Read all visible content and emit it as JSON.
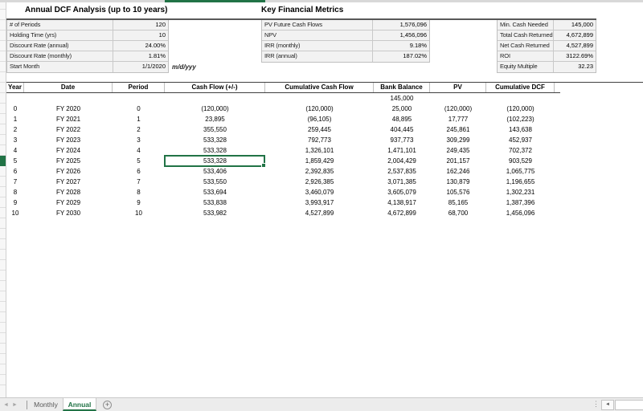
{
  "colors": {
    "accent_green": "#217346",
    "table_fill": "#f2f2f2",
    "table_border": "#bfbfbf",
    "dark_rule": "#595959"
  },
  "left_section": {
    "title": "Annual DCF Analysis (up to 10 years)",
    "rows": [
      {
        "label": "# of Periods",
        "value": "120"
      },
      {
        "label": "Holding Time (yrs)",
        "value": "10"
      },
      {
        "label": "Discount Rate (annual)",
        "value": "24.00%"
      },
      {
        "label": "Discount Rate (monthly)",
        "value": "1.81%"
      },
      {
        "label": "Start Month",
        "value": "1/1/2020"
      }
    ],
    "date_format_note": "m/d/yyy"
  },
  "metrics_section": {
    "title": "Key Financial Metrics",
    "rows": [
      {
        "label": "PV Future Cash Flows",
        "value": "1,576,096"
      },
      {
        "label": "NPV",
        "value": "1,456,096"
      },
      {
        "label": "IRR (monthly)",
        "value": "9.18%"
      },
      {
        "label": "IRR (annual)",
        "value": "187.02%"
      }
    ]
  },
  "returns_section": {
    "rows": [
      {
        "label": "Min. Cash Needed",
        "value": "145,000"
      },
      {
        "label": "Total Cash Returned",
        "value": "4,672,899"
      },
      {
        "label": "Net Cash Returned",
        "value": "4,527,899"
      },
      {
        "label": "ROI",
        "value": "3122.69%"
      },
      {
        "label": "Equity Multiple",
        "value": "32.23"
      }
    ]
  },
  "main_table": {
    "headers": [
      "Year",
      "Date",
      "Period",
      "Cash Flow (+/-)",
      "Cumulative Cash Flow",
      "Bank Balance",
      "PV",
      "Cumulative DCF"
    ],
    "initial_row": [
      "",
      "",
      "",
      "",
      "",
      "145,000",
      "",
      ""
    ],
    "rows": [
      [
        "0",
        "FY 2020",
        "0",
        "(120,000)",
        "(120,000)",
        "25,000",
        "(120,000)",
        "(120,000)"
      ],
      [
        "1",
        "FY 2021",
        "1",
        "23,895",
        "(96,105)",
        "48,895",
        "17,777",
        "(102,223)"
      ],
      [
        "2",
        "FY 2022",
        "2",
        "355,550",
        "259,445",
        "404,445",
        "245,861",
        "143,638"
      ],
      [
        "3",
        "FY 2023",
        "3",
        "533,328",
        "792,773",
        "937,773",
        "309,299",
        "452,937"
      ],
      [
        "4",
        "FY 2024",
        "4",
        "533,328",
        "1,326,101",
        "1,471,101",
        "249,435",
        "702,372"
      ],
      [
        "5",
        "FY 2025",
        "5",
        "533,328",
        "1,859,429",
        "2,004,429",
        "201,157",
        "903,529"
      ],
      [
        "6",
        "FY 2026",
        "6",
        "533,406",
        "2,392,835",
        "2,537,835",
        "162,246",
        "1,065,775"
      ],
      [
        "7",
        "FY 2027",
        "7",
        "533,550",
        "2,926,385",
        "3,071,385",
        "130,879",
        "1,196,655"
      ],
      [
        "8",
        "FY 2028",
        "8",
        "533,694",
        "3,460,079",
        "3,605,079",
        "105,576",
        "1,302,231"
      ],
      [
        "9",
        "FY 2029",
        "9",
        "533,838",
        "3,993,917",
        "4,138,917",
        "85,165",
        "1,387,396"
      ],
      [
        "10",
        "FY 2030",
        "10",
        "533,982",
        "4,527,899",
        "4,672,899",
        "68,700",
        "1,456,096"
      ]
    ],
    "selected_cell": {
      "row_year": "5",
      "column": "Cash Flow (+/-)",
      "value": "533,328"
    }
  },
  "sheet_tabs": {
    "tabs": [
      "Monthly",
      "Annual"
    ],
    "active_tab": "Annual",
    "new_sheet_label": "+",
    "nav_prev": "◄",
    "nav_next": "►",
    "scroll_left": "◄",
    "splitter_glyph": "⋮"
  }
}
